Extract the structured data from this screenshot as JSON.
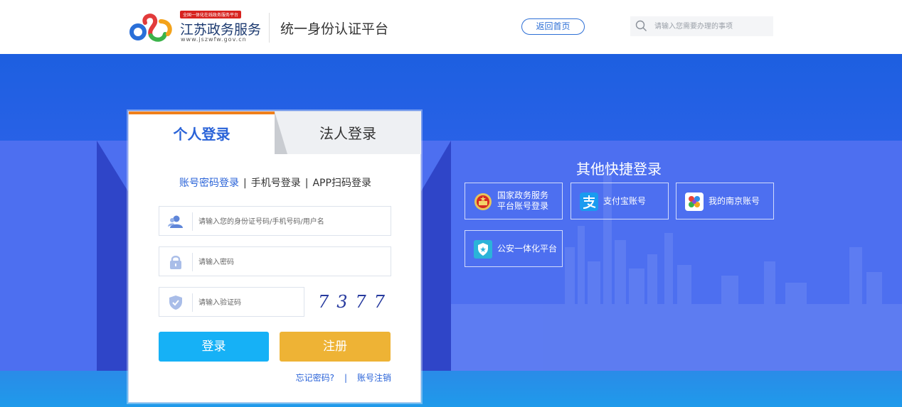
{
  "header": {
    "brand_tag": "全国一体化在线政务服务平台",
    "brand_name": "江苏政务服务",
    "brand_url": "www.jszwfw.gov.cn",
    "platform_title": "统一身份认证平台",
    "home_label": "返回首页",
    "search_placeholder": "请输入您需要办理的事项"
  },
  "login": {
    "tabs": [
      {
        "label": "个人登录",
        "active": true
      },
      {
        "label": "法人登录",
        "active": false
      }
    ],
    "methods": [
      "账号密码登录",
      "手机号登录",
      "APP扫码登录"
    ],
    "method_separator": "|",
    "username_placeholder": "请输入您的身份证号码/手机号码/用户名",
    "password_placeholder": "请输入密码",
    "captcha_placeholder": "请输入验证码",
    "captcha_code": "7377",
    "login_label": "登录",
    "register_label": "注册",
    "forgot_label": "忘记密码?",
    "link_separator": "|",
    "cancel_account_label": "账号注销"
  },
  "quick_login": {
    "title": "其他快捷登录",
    "items": [
      {
        "label": "国家政务服务\n平台账号登录",
        "icon": "national-emblem-icon"
      },
      {
        "label": "支付宝账号",
        "icon": "alipay-icon"
      },
      {
        "label": "我的南京账号",
        "icon": "my-nanjing-icon"
      },
      {
        "label": "公安一体化平台",
        "icon": "police-shield-icon"
      }
    ]
  },
  "colors": {
    "accent_blue": "#2a63d8",
    "tab_orange": "#f07f1a",
    "login_button": "#16b1f6",
    "register_button": "#eeb335",
    "banner_blue": "#1d5fe0"
  }
}
